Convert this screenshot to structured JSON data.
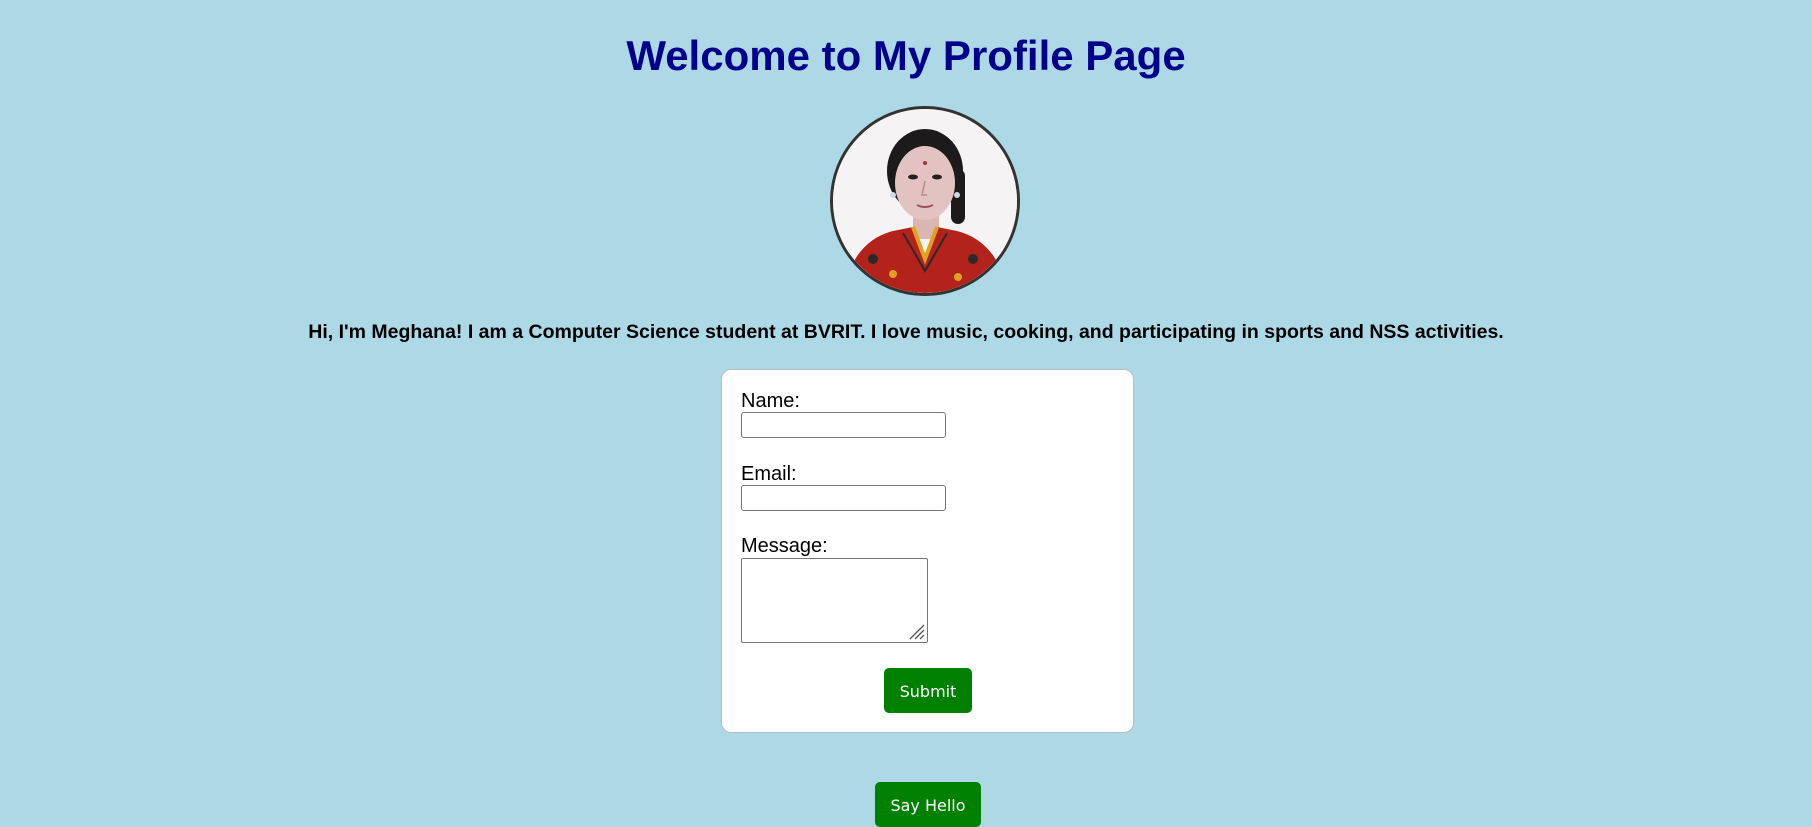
{
  "page": {
    "title": "Welcome to My Profile Page",
    "bio": "Hi, I'm Meghana! I am a Computer Science student at BVRIT. I love music, cooking, and participating in sports and NSS activities."
  },
  "form": {
    "name_label": "Name:",
    "name_value": "",
    "email_label": "Email:",
    "email_value": "",
    "message_label": "Message:",
    "message_value": "",
    "submit_label": "Submit"
  },
  "say_hello_label": "Say Hello",
  "colors": {
    "background": "#add8e6",
    "title": "#00008b",
    "button": "#008000",
    "card": "#ffffff"
  }
}
